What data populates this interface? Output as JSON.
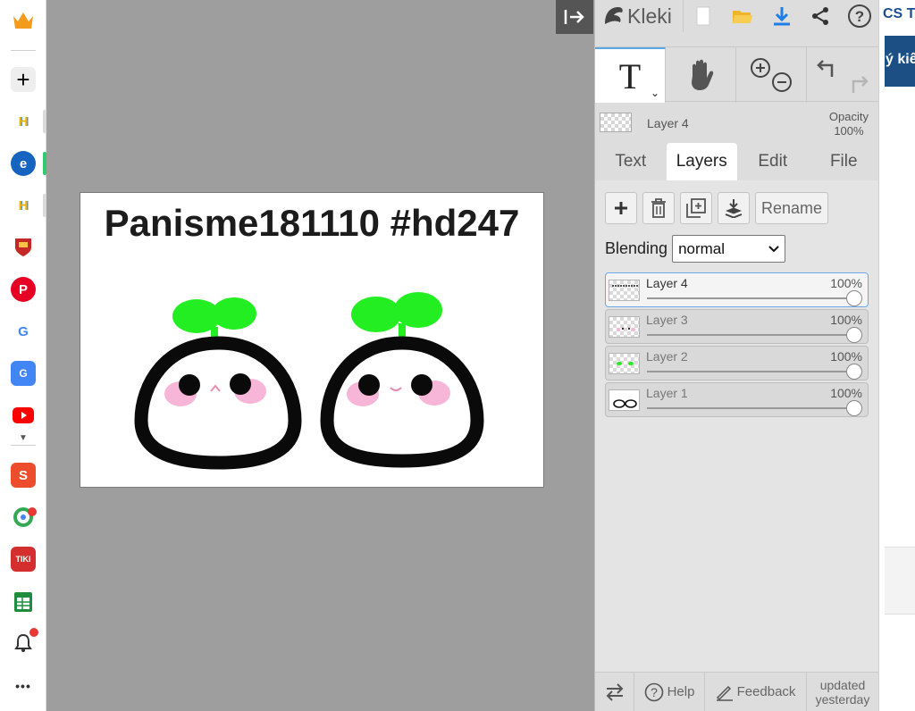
{
  "browser_sidebar": {
    "items": [
      {
        "name": "crown-icon",
        "color": "#f29b1d"
      },
      {
        "name": "add-icon",
        "glyph": "+"
      },
      {
        "name": "h-app-icon",
        "glyph": "H",
        "color": "#2f7bd6"
      },
      {
        "name": "edge-icon",
        "glyph": "e",
        "color": "#1565c0"
      },
      {
        "name": "h-app-icon-2",
        "glyph": "H",
        "color": "#2f7bd6"
      },
      {
        "name": "shield-app-icon",
        "color": "#c62828"
      },
      {
        "name": "pinterest-icon",
        "glyph": "P",
        "color": "#e60023"
      },
      {
        "name": "google-icon",
        "glyph": "G",
        "color": "#4285f4"
      },
      {
        "name": "translate-icon",
        "glyph": "G",
        "color": "#4285f4"
      },
      {
        "name": "youtube-icon",
        "color": "#ff0000"
      },
      {
        "name": "shopee-icon",
        "glyph": "S",
        "color": "#ee4d2d"
      },
      {
        "name": "maps-icon",
        "color": "#34a853"
      },
      {
        "name": "tiki-icon",
        "glyph": "TIKI",
        "color": "#d32f2f"
      },
      {
        "name": "sheets-icon",
        "color": "#1e8e3e"
      },
      {
        "name": "bell-icon"
      },
      {
        "name": "more-icon",
        "glyph": "•••"
      }
    ]
  },
  "canvas": {
    "text": "Panisme181110 #hd247"
  },
  "panel": {
    "logo": "Kleki",
    "active_layer": {
      "name": "Layer 4",
      "opacity_label": "Opacity",
      "opacity_value": "100%"
    },
    "tabs": [
      {
        "label": "Text",
        "active": false
      },
      {
        "label": "Layers",
        "active": true
      },
      {
        "label": "Edit",
        "active": false
      },
      {
        "label": "File",
        "active": false
      }
    ],
    "rename_label": "Rename",
    "blending_label": "Blending",
    "blending_value": "normal",
    "layers": [
      {
        "name": "Layer 4",
        "opacity": "100%",
        "selected": true
      },
      {
        "name": "Layer 3",
        "opacity": "100%",
        "selected": false
      },
      {
        "name": "Layer 2",
        "opacity": "100%",
        "selected": false
      },
      {
        "name": "Layer 1",
        "opacity": "100%",
        "selected": false
      }
    ],
    "footer": {
      "help": "Help",
      "feedback": "Feedback",
      "updated_line1": "updated",
      "updated_line2": "yesterday"
    }
  },
  "peek": {
    "top_text": "CS T",
    "bar_text": "ý kiế"
  },
  "colors": {
    "accent_blue": "#5aa7e6",
    "sprout_green": "#22ee22",
    "blush_pink": "#f7b6d8"
  }
}
